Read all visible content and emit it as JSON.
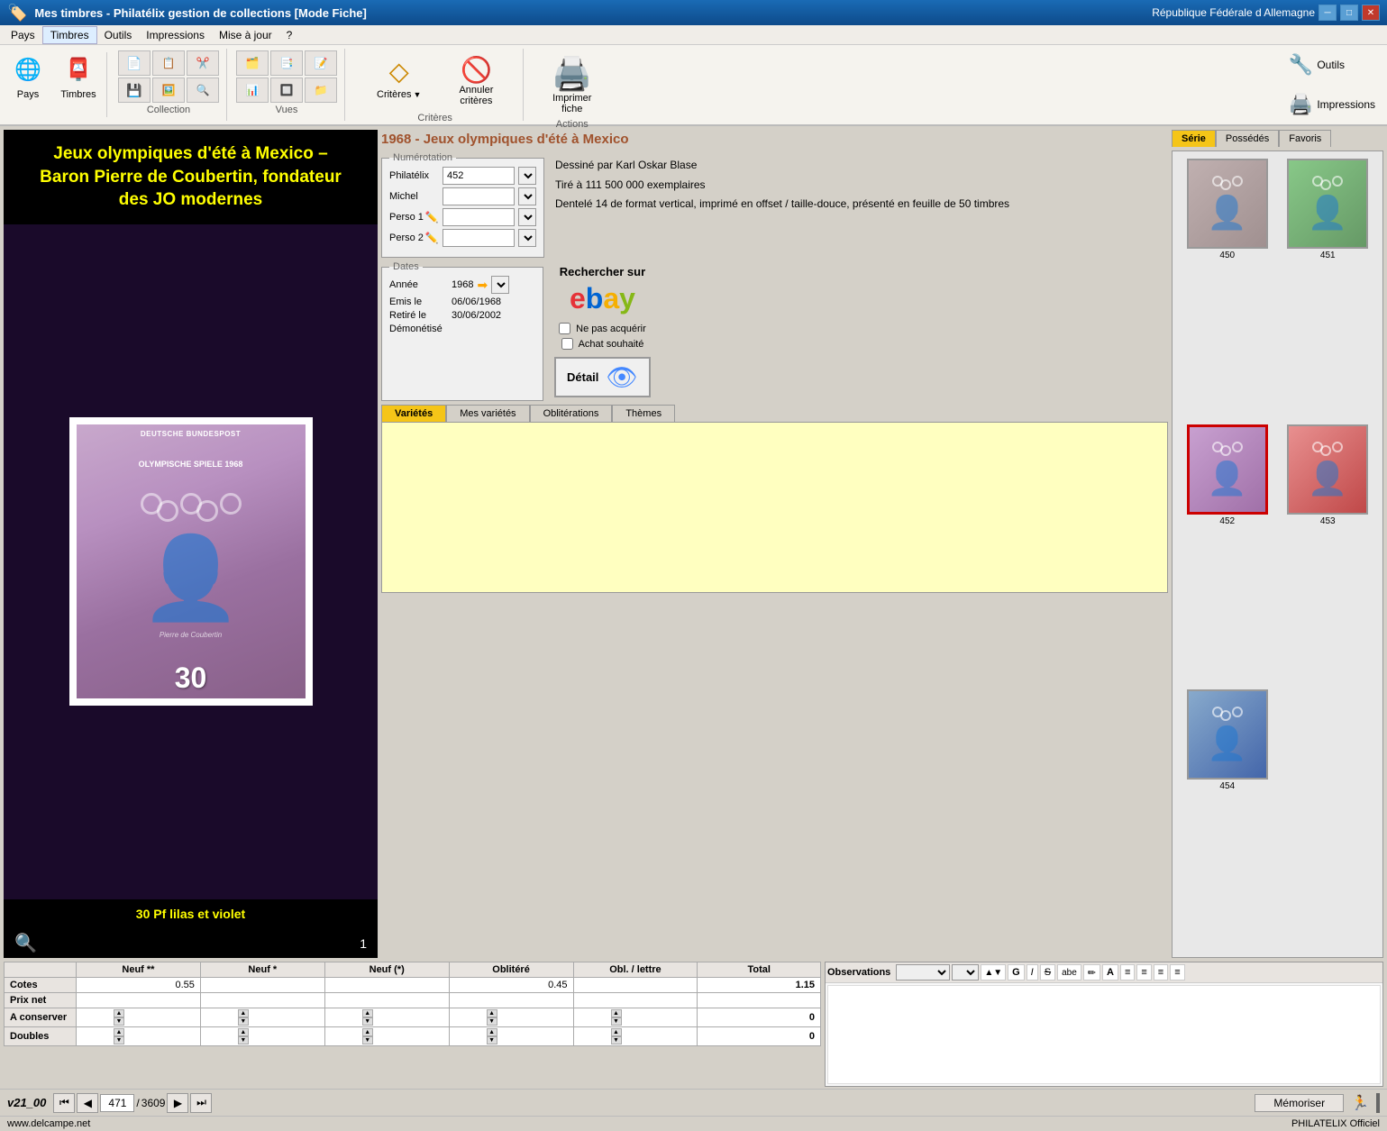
{
  "app": {
    "title": "Mes timbres - Philatélix gestion de collections [Mode Fiche]",
    "title_right": "République Fédérale d Allemagne"
  },
  "menu": {
    "items": [
      "Pays",
      "Timbres",
      "Outils",
      "Impressions",
      "Mise à jour",
      "?"
    ],
    "active": "Timbres"
  },
  "toolbar": {
    "groups": [
      {
        "id": "pays",
        "label": "Pays",
        "icon": "🌐"
      },
      {
        "id": "timbres",
        "label": "Timbres",
        "icon": "📮"
      },
      {
        "id": "outils",
        "label": "Outils",
        "icon": "🔧"
      },
      {
        "id": "impressions",
        "label": "Impressions",
        "icon": "🖨️"
      }
    ],
    "collection_label": "Collection",
    "vues_label": "Vues",
    "criteres_label": "Critères",
    "actions_label": "Actions",
    "criteres_btn": "Critères",
    "annuler_btn": "Annuler\ncritères",
    "imprimer_btn": "Imprimer\nfiche"
  },
  "stamp": {
    "title_left": "Jeux olympiques d'été à Mexico –\nBaron Pierre de Coubertin, fondateur\ndes JO modernes",
    "header": "1968 - Jeux olympiques d'été à Mexico",
    "caption": "30 Pf lilas et violet",
    "counter": "1",
    "stamp_text": "DEUTSCHE BUNDESPOST\nOLYMPISCHE SPIELE 1968",
    "value_text": "30"
  },
  "numerotation": {
    "legend": "Numérotation",
    "philatelix_label": "Philatélix",
    "philatelix_value": "452",
    "michel_label": "Michel",
    "perso1_label": "Perso 1",
    "perso2_label": "Perso 2"
  },
  "description": {
    "line1": "Dessiné par Karl Oskar Blase",
    "line2": "Tiré à 111 500 000 exemplaires",
    "line3": "Dentelé 14 de format vertical, imprimé en offset / taille-douce, présenté en feuille de 50 timbres"
  },
  "dates": {
    "legend": "Dates",
    "annee_label": "Année",
    "annee_value": "1968",
    "emis_label": "Emis le",
    "emis_value": "06/06/1968",
    "retire_label": "Retiré le",
    "retire_value": "30/06/2002",
    "demonetise_label": "Démonétisé"
  },
  "ebay": {
    "label": "Rechercher sur",
    "logo": "ebay"
  },
  "checkboxes": {
    "ne_pas": "Ne pas acquérir",
    "achat": "Achat souhaité"
  },
  "detail_btn": "Détail",
  "tabs": {
    "items": [
      "Variétés",
      "Mes variétés",
      "Oblitérations",
      "Thèmes"
    ],
    "active": "Variétés"
  },
  "right_tabs": {
    "items": [
      "Série",
      "Possédés",
      "Favoris"
    ],
    "active": "Série"
  },
  "thumbnails": [
    {
      "id": "450",
      "number": "450",
      "color_class": "thumb-450"
    },
    {
      "id": "451",
      "number": "451",
      "color_class": "thumb-451"
    },
    {
      "id": "452",
      "number": "452",
      "color_class": "thumb-452",
      "selected": true
    },
    {
      "id": "453",
      "number": "453",
      "color_class": "thumb-453"
    },
    {
      "id": "454",
      "number": "454",
      "color_class": "thumb-454"
    }
  ],
  "price_table": {
    "headers": [
      "Neuf **",
      "Neuf *",
      "Neuf (*)",
      "Oblitéré",
      "Obl. / lettre",
      "Total"
    ],
    "rows": [
      {
        "label": "Cotes",
        "values": [
          "0.55",
          "",
          "",
          "0.45",
          "",
          "1.15"
        ]
      },
      {
        "label": "Prix net",
        "values": [
          "",
          "",
          "",
          "",
          "",
          ""
        ]
      },
      {
        "label": "A conserver",
        "values": [
          "",
          "",
          "",
          "",
          "",
          "0"
        ]
      },
      {
        "label": "Doubles",
        "values": [
          "",
          "",
          "",
          "",
          "",
          "0"
        ]
      }
    ]
  },
  "observations": {
    "legend": "Observations",
    "toolbar_items": [
      "▼",
      "▼",
      "▲▼",
      "G",
      "I",
      "S",
      "abe",
      "✏",
      "A",
      "≡",
      "≡",
      "≡",
      "≡"
    ]
  },
  "nav": {
    "version": "v21_00",
    "current_page": "471",
    "total_pages": "3609",
    "memoriser": "Mémoriser"
  },
  "status": {
    "left": "www.delcampe.net",
    "right": "PHILATELIX Officiel"
  }
}
